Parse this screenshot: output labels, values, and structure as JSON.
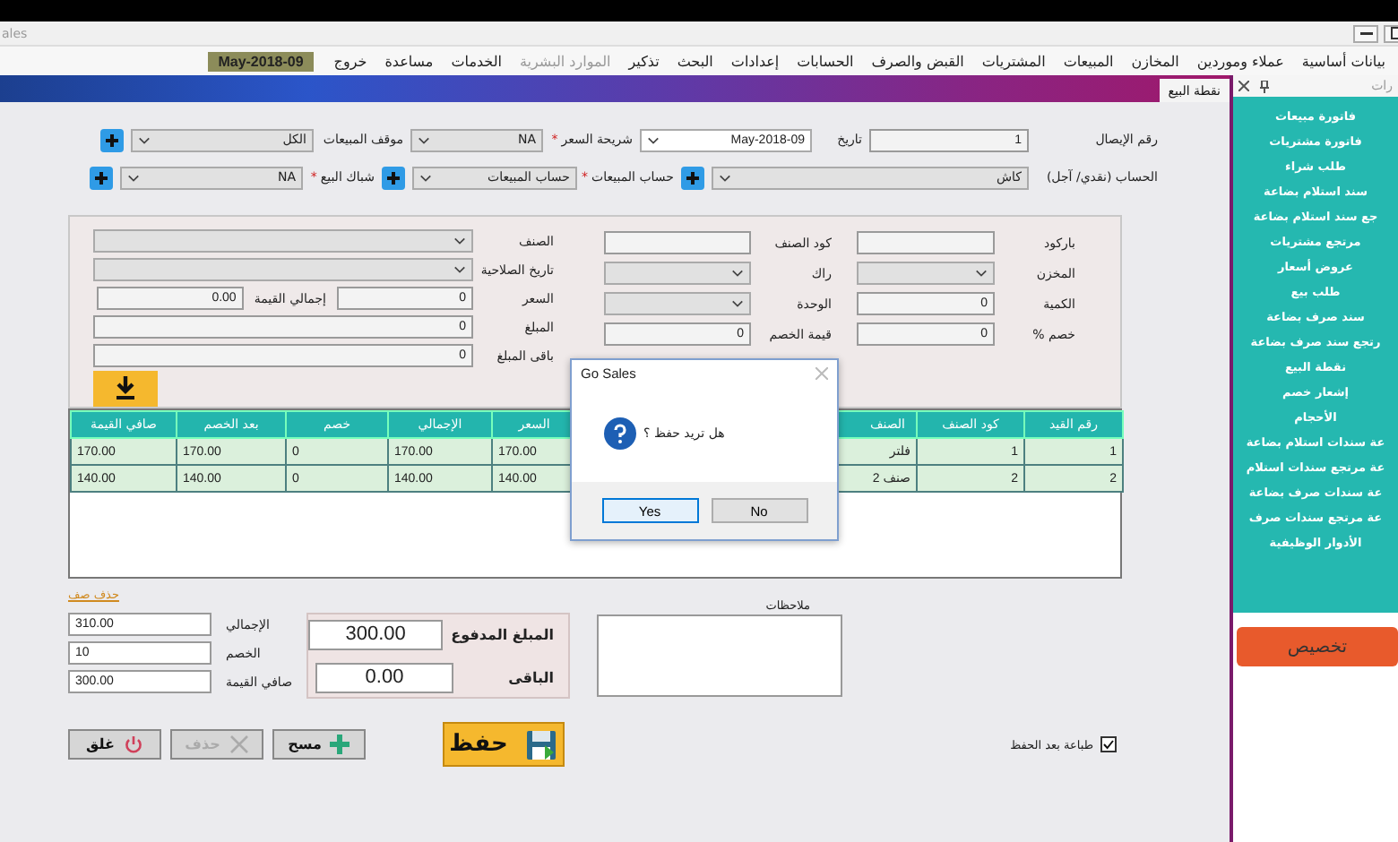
{
  "window": {
    "title": "ales"
  },
  "menu": [
    {
      "label": "بيانات أساسية",
      "disabled": false
    },
    {
      "label": "عملاء وموردين",
      "disabled": false
    },
    {
      "label": "المخازن",
      "disabled": false
    },
    {
      "label": "المبيعات",
      "disabled": false
    },
    {
      "label": "المشتريات",
      "disabled": false
    },
    {
      "label": "القبض والصرف",
      "disabled": false
    },
    {
      "label": "الحسابات",
      "disabled": false
    },
    {
      "label": "إعدادات",
      "disabled": false
    },
    {
      "label": "البحث",
      "disabled": false
    },
    {
      "label": "تذكير",
      "disabled": false
    },
    {
      "label": "الموارد البشرية",
      "disabled": true
    },
    {
      "label": "الخدمات",
      "disabled": false
    },
    {
      "label": "مساعدة",
      "disabled": false
    },
    {
      "label": "خروج",
      "disabled": false
    }
  ],
  "menu_date": "May-2018-09",
  "tabs": [
    {
      "label": "نقطة البيع",
      "selected": true
    }
  ],
  "header_rows": [
    [
      {
        "label": "رقم الإيصال",
        "kind": "input",
        "value": "1",
        "add": false
      },
      {
        "label": "تاريخ",
        "kind": "date",
        "value": "May-2018-09",
        "add": false
      },
      {
        "label": "شريحة السعر",
        "required_mark": "*",
        "kind": "select",
        "value": "NA",
        "add": false
      },
      {
        "label": "موقف المبيعات",
        "kind": "select",
        "value": "الكل",
        "add": true
      }
    ],
    [
      {
        "label": "الحساب (نقدي/ آجل)",
        "kind": "select",
        "value": "كاش",
        "add": true
      },
      {
        "label": "حساب المبيعات",
        "required_mark": "*",
        "kind": "select",
        "value": "حساب المبيعات",
        "add": true
      },
      {
        "label": "شباك البيع",
        "required_mark": "*",
        "kind": "select",
        "value": "NA",
        "add": true
      }
    ]
  ],
  "item_panel": {
    "columns": [
      [
        {
          "label": "باركود",
          "kind": "input"
        },
        {
          "label": "المخزن",
          "kind": "select"
        },
        {
          "label": "الكمية",
          "kind": "input",
          "value": "0"
        },
        {
          "label": "خصم %",
          "kind": "input",
          "value": "0"
        }
      ],
      [
        {
          "label": "كود الصنف",
          "kind": "input"
        },
        {
          "label": "راك",
          "kind": "select"
        },
        {
          "label": "الوحدة",
          "kind": "select"
        },
        {
          "label": "قيمة الخصم",
          "kind": "input",
          "value": "0"
        }
      ],
      [
        {
          "label": "الصنف",
          "kind": "select"
        },
        {
          "label": "تاريخ الصلاحية",
          "kind": "select"
        },
        {
          "label": "السعر",
          "kind": "input",
          "value": "0",
          "sub": {
            "label": "إجمالي القيمة",
            "value": "0.00"
          }
        },
        {
          "label": "المبلغ",
          "kind": "input",
          "value": "0"
        },
        {
          "label": "باقى المبلغ",
          "kind": "input",
          "value": "0"
        }
      ]
    ]
  },
  "table": {
    "columns": [
      "رقم القيد",
      "كود الصنف",
      "الصنف",
      "السعر",
      "الإجمالي",
      "خصم",
      "بعد الخصم",
      "صافي القيمة"
    ],
    "rows": [
      [
        "1",
        "1",
        "فلتر",
        "170.00",
        "170.00",
        "0",
        "170.00",
        "170.00"
      ],
      [
        "2",
        "2",
        "صنف 2",
        "140.00",
        "140.00",
        "0",
        "140.00",
        "140.00"
      ]
    ]
  },
  "delete_row_link": "حذف صف",
  "totals": [
    {
      "label": "الإجمالي",
      "value": "310.00"
    },
    {
      "label": "الخصم",
      "value": "10"
    },
    {
      "label": "صافي القيمة",
      "value": "300.00"
    }
  ],
  "payment": [
    {
      "label": "المبلغ المدفوع",
      "value": "300.00"
    },
    {
      "label": "الباقى",
      "value": "0.00"
    }
  ],
  "notes": {
    "label": "ملاحظات"
  },
  "buttons": [
    {
      "label": "مسح",
      "kind": "clear",
      "disabled": false
    },
    {
      "label": "حذف",
      "kind": "delete",
      "disabled": true
    },
    {
      "label": "غلق",
      "kind": "close",
      "disabled": false
    }
  ],
  "save_button": {
    "label": "حفظ"
  },
  "print_after_save": {
    "label": "طباعة بعد الحفظ",
    "checked": true
  },
  "dialog": {
    "title": "Go Sales",
    "message": "هل تريد حفظ ؟",
    "buttons": [
      {
        "label": "No",
        "focused": false
      },
      {
        "label": "Yes",
        "focused": true
      }
    ]
  },
  "sidebar": {
    "title": "رات",
    "items": [
      "فاتورة مبيعات",
      "فاتورة مشتريات",
      "طلب شراء",
      "سند استلام بضاعة",
      "جع سند استلام بضاعة",
      "مرتجع مشتريات",
      "عروض أسعار",
      "طلب بيع",
      "سند صرف بضاعة",
      "رتجع سند صرف بضاعة",
      "نقطة البيع",
      "إشعار خصم",
      "الأحجام",
      "عة سندات استلام بضاعة",
      "عة مرتجع سندات استلام",
      "عة سندات صرف بضاعة",
      "عة مرتجع سندات صرف",
      "الأدوار الوظيفية"
    ],
    "customize_button": "تخصيص"
  }
}
